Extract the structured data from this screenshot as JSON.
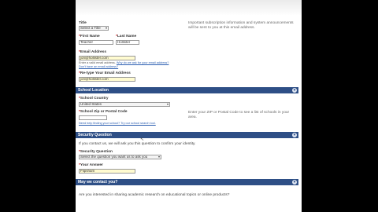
{
  "form": {
    "title_label": "Title",
    "title_select": "Select a Title",
    "first_name_label": "First Name",
    "first_name_value": "Teacher",
    "last_name_label": "Last Name",
    "last_name_value": "Hollister",
    "email_label": "Email Address",
    "email_value": "jon@hollister.com",
    "email_note": "Enter a valid email address.",
    "email_note_link": "Why do we ask for your email address?",
    "email_note_link2": "Don't have an email address?",
    "reemail_label": "Re-type Your Email Address",
    "reemail_value": "jon@hollister.com",
    "side_note": "Important subscription information and system announcements will be sent to you at this email address."
  },
  "school": {
    "header": "School Location",
    "country_label": "School Country",
    "country_value": "United States",
    "zip_label": "School Zip or Postal Code",
    "zip_note": "Enter your ZIP or Postal Code to see a list of schools in your area.",
    "zip_link": "Need help finding your school? Try our school search tool."
  },
  "security": {
    "header": "Security Question",
    "intro": "If you contact us, we will ask you this question to confirm your identity.",
    "question_label": "Security Question",
    "question_value": "Select the question you want us to ask you",
    "answer_label": "Your Answer",
    "answer_value": "Flipsham"
  },
  "contact": {
    "header": "May we contact you?",
    "question": "Are you interested in sharing academic research on educational topics or online products?"
  },
  "icons": {
    "required_mark": "*",
    "chevron": "▾",
    "cursor": "arrow-cursor"
  }
}
